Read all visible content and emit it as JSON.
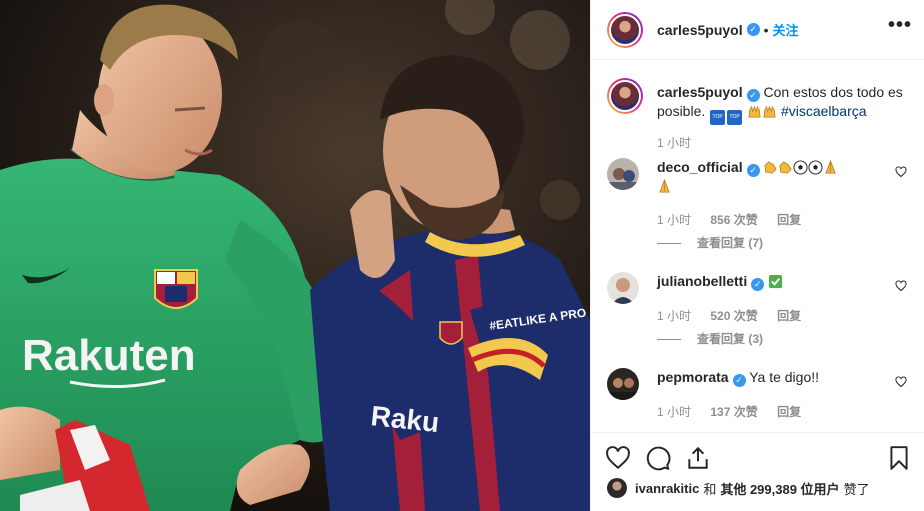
{
  "post": {
    "username": "carles5puyol",
    "verified_mark": "✓",
    "separator": "•",
    "follow_label": "关注",
    "more_label": "•••",
    "caption": {
      "username": "carles5puyol",
      "text_before": "Con estos dos todo es posible.",
      "emojis": [
        "top-badge-emoji",
        "top-badge-emoji",
        "raised-hands-emoji",
        "raised-hands-emoji"
      ],
      "hashtag": "#viscaelbarça",
      "time": "1 小时"
    },
    "comments": [
      {
        "username": "deco_official",
        "emojis": [
          "clapping-hands-emoji",
          "clapping-hands-emoji",
          "soccer-ball-emoji",
          "soccer-ball-emoji",
          "folded-hands-emoji",
          "folded-hands-emoji"
        ],
        "text": "",
        "time": "1 小时",
        "likes": "856 次赞",
        "reply": "回复",
        "view_replies": "查看回复 (7)"
      },
      {
        "username": "julianobelletti",
        "emojis": [
          "check-mark-button-emoji"
        ],
        "text": "",
        "time": "1 小时",
        "likes": "520 次赞",
        "reply": "回复",
        "view_replies": "查看回复 (3)"
      },
      {
        "username": "pepmorata",
        "emojis": [],
        "text": "Ya te digo!!",
        "time": "1 小时",
        "likes": "137 次赞",
        "reply": "回复"
      }
    ],
    "actions": {
      "icons": [
        "heart-icon",
        "comment-icon",
        "share-icon",
        "bookmark-icon"
      ]
    },
    "likes_line": {
      "user": "ivanrakitic",
      "conj": "和",
      "others": "其他 299,389 位用户",
      "suffix": "赞了"
    },
    "photo_text": {
      "sponsor_left": "Rakuten",
      "sponsor_right": "Raku",
      "sleeve_text": "#EATLIKE A PRO"
    }
  },
  "colors": {
    "accent": "#0095f6",
    "verified": "#3897f0",
    "secondary_text": "#8e8e8e",
    "keeper_green": "#2fa868",
    "barca_blue": "#1d2c6b",
    "barca_red": "#a31f3a"
  }
}
